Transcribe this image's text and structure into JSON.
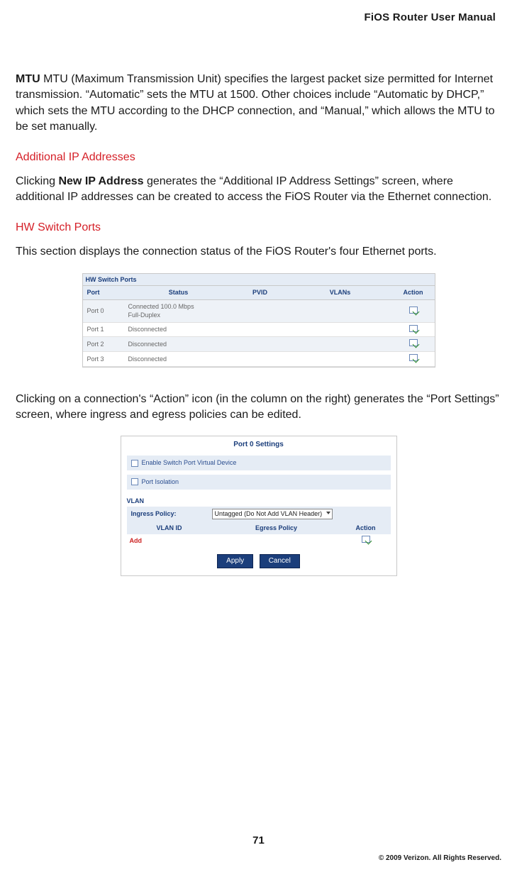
{
  "header": {
    "title": "FiOS Router User Manual"
  },
  "mtu": {
    "label": "MTU",
    "text": "  MTU (Maximum Transmission Unit) specifies the largest packet size permitted for Internet transmission. “Automatic” sets the MTU at 1500. Other choices include “Automatic by DHCP,” which sets the MTU according to the DHCP connection, and “Manual,” which allows the MTU to be set manually."
  },
  "sections": {
    "additional_ip": {
      "heading": "Additional IP Addresses",
      "p_before": "Clicking ",
      "p_bold": "New IP Address",
      "p_after": " generates the “Additional IP Address Settings” screen, where additional IP addresses can be created to access the FiOS Router via the Ethernet connection."
    },
    "hw_switch": {
      "heading": "HW Switch Ports",
      "p1": "This section displays the connection status of the FiOS Router's four Ethernet ports.",
      "p2": "Clicking on a connection's “Action” icon (in the column on the right) generates the “Port Settings” screen, where ingress and egress policies can be edited."
    }
  },
  "table1": {
    "title": "HW Switch Ports",
    "cols": {
      "port": "Port",
      "status": "Status",
      "pvid": "PVID",
      "vlans": "VLANs",
      "action": "Action"
    },
    "rows": [
      {
        "port": "Port 0",
        "status": "Connected 100.0 Mbps\nFull-Duplex",
        "connected": true
      },
      {
        "port": "Port 1",
        "status": "Disconnected",
        "connected": false
      },
      {
        "port": "Port 2",
        "status": "Disconnected",
        "connected": false
      },
      {
        "port": "Port 3",
        "status": "Disconnected",
        "connected": false
      }
    ]
  },
  "panel": {
    "title": "Port 0 Settings",
    "opt1": "Enable Switch Port Virtual Device",
    "opt2": "Port Isolation",
    "vlan_label": "VLAN",
    "ingress_label": "Ingress Policy:",
    "ingress_value": "Untagged (Do Not Add VLAN Header)",
    "table_cols": {
      "vlanid": "VLAN ID",
      "egress": "Egress Policy",
      "action": "Action"
    },
    "add": "Add",
    "apply": "Apply",
    "cancel": "Cancel"
  },
  "footer": {
    "page": "71",
    "copyright": "© 2009 Verizon. All Rights Reserved."
  }
}
